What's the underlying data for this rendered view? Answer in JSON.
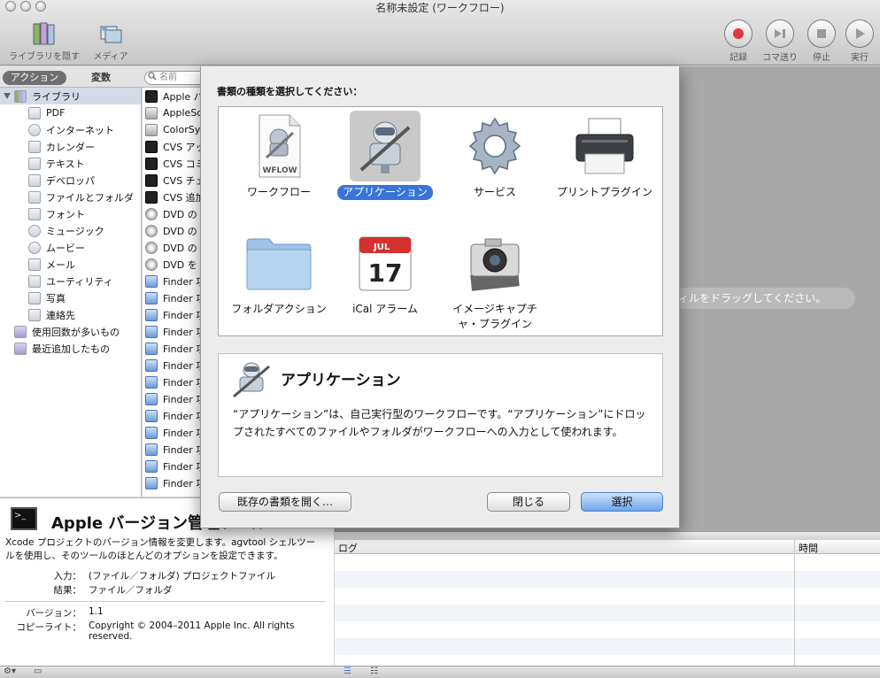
{
  "window": {
    "title": "名称未設定 (ワークフロー)"
  },
  "toolbar": {
    "library_label": "ライブラリを隠す",
    "media_label": "メディア",
    "record_label": "記録",
    "step_label": "コマ送り",
    "stop_label": "停止",
    "run_label": "実行",
    "record_color": "#e0393b"
  },
  "library": {
    "tab_actions": "アクション",
    "tab_variables": "変数",
    "search_placeholder": "名前",
    "categories": [
      "ライブラリ",
      "PDF",
      "インターネット",
      "カレンダー",
      "テキスト",
      "デベロッパ",
      "ファイルとフォルダ",
      "フォント",
      "ミュージック",
      "ムービー",
      "メール",
      "ユーティリティ",
      "写真",
      "連絡先",
      "使用回数が多いもの",
      "最近追加したもの"
    ],
    "actions": [
      "Apple バ",
      "AppleSc",
      "ColorSy",
      "CVS アッ",
      "CVS コミ",
      "CVS チェ",
      "CVS 追加",
      "DVD の",
      "DVD の",
      "DVD の",
      "DVD を",
      "Finder 項",
      "Finder 項",
      "Finder 項",
      "Finder 項",
      "Finder 項",
      "Finder 項",
      "Finder 項",
      "Finder 項",
      "Finder 項",
      "Finder 項",
      "Finder 項",
      "Finder 項",
      "Finder 項"
    ]
  },
  "description": {
    "title": "Apple バージョン管理ツール",
    "text": "Xcode プロジェクトのバージョン情報を変更します。agvtool シェルツールを使用し、そのツールのほとんどのオプションを設定できます。",
    "input_label": "入力：",
    "input_value": "(ファイル／フォルダ) プロジェクトファイル",
    "result_label": "結果：",
    "result_value": "ファイル／フォルダ",
    "version_label": "バージョン：",
    "version_value": "1.1",
    "copyright_label": "コピーライト：",
    "copyright_value": "Copyright © 2004–2011 Apple Inc.  All rights reserved."
  },
  "workflow": {
    "drop_hint": "ィルをドラッグしてください。"
  },
  "log": {
    "col_log": "ログ",
    "col_time": "時間"
  },
  "sheet": {
    "prompt": "書類の種類を選択してください：",
    "types": [
      {
        "label": "ワークフロー",
        "icon": "workflow-document-icon"
      },
      {
        "label": "アプリケーション",
        "icon": "automator-robot-icon"
      },
      {
        "label": "サービス",
        "icon": "gear-icon"
      },
      {
        "label": "プリントプラグイン",
        "icon": "printer-icon"
      },
      {
        "label": "フォルダアクション",
        "icon": "folder-icon"
      },
      {
        "label": "iCal アラーム",
        "icon": "calendar-icon"
      },
      {
        "label": "イメージキャプチャ・プラグイン",
        "icon": "camera-icon"
      }
    ],
    "selected_index": 1,
    "wflow_badge": "WFLOW",
    "cal_month": "JUL",
    "cal_day": "17",
    "detail_title": "アプリケーション",
    "detail_text": "“アプリケーション”は、自己実行型のワークフローです。“アプリケーション”にドロップされたすべてのファイルやフォルダがワークフローへの入力として使われます。",
    "btn_open": "既存の書類を開く…",
    "btn_close": "閉じる",
    "btn_select": "選択",
    "accent": "#3875d7"
  }
}
